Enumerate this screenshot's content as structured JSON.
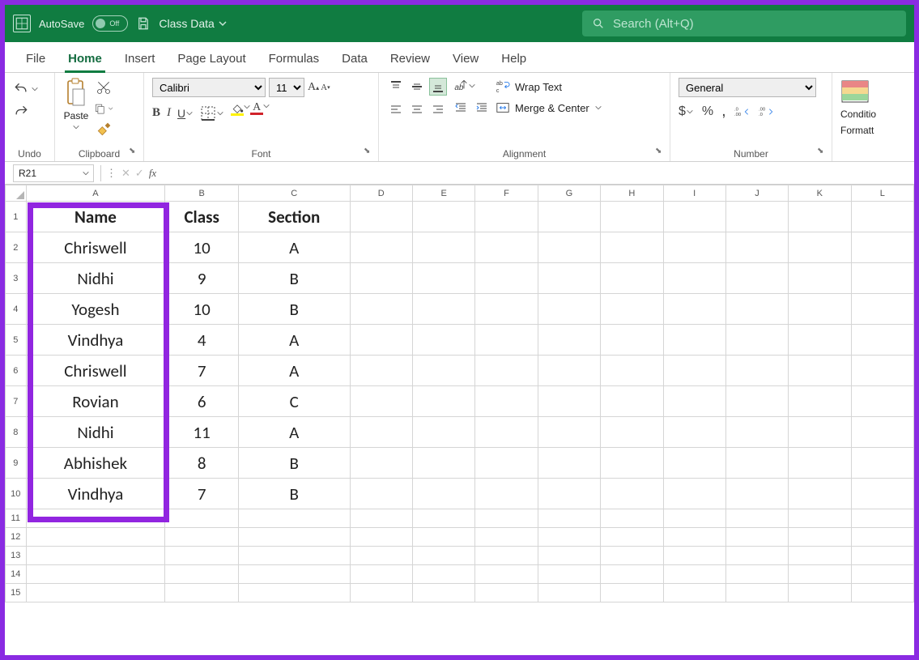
{
  "titlebar": {
    "autosave_label": "AutoSave",
    "autosave_state": "Off",
    "filename": "Class Data",
    "search_placeholder": "Search (Alt+Q)"
  },
  "ribbon_tabs": [
    "File",
    "Home",
    "Insert",
    "Page Layout",
    "Formulas",
    "Data",
    "Review",
    "View",
    "Help"
  ],
  "active_tab": "Home",
  "ribbon": {
    "undo_label": "Undo",
    "clipboard_label": "Clipboard",
    "paste_label": "Paste",
    "font_label": "Font",
    "font_name": "Calibri",
    "font_size": "11",
    "alignment_label": "Alignment",
    "wrap_text_label": "Wrap Text",
    "merge_center_label": "Merge & Center",
    "number_label": "Number",
    "number_format": "General",
    "cond_fmt_label1": "Conditio",
    "cond_fmt_label2": "Formatt"
  },
  "name_box": "R21",
  "formula_value": "",
  "columns": [
    "A",
    "B",
    "C",
    "D",
    "E",
    "F",
    "G",
    "H",
    "I",
    "J",
    "K",
    "L"
  ],
  "row_count": 15,
  "data": {
    "headers": [
      "Name",
      "Class",
      "Section"
    ],
    "rows": [
      [
        "Chriswell",
        "10",
        "A"
      ],
      [
        "Nidhi",
        "9",
        "B"
      ],
      [
        "Yogesh",
        "10",
        "B"
      ],
      [
        "Vindhya",
        "4",
        "A"
      ],
      [
        "Chriswell",
        "7",
        "A"
      ],
      [
        "Rovian",
        "6",
        "C"
      ],
      [
        "Nidhi",
        "11",
        "A"
      ],
      [
        "Abhishek",
        "8",
        "B"
      ],
      [
        "Vindhya",
        "7",
        "B"
      ]
    ]
  }
}
